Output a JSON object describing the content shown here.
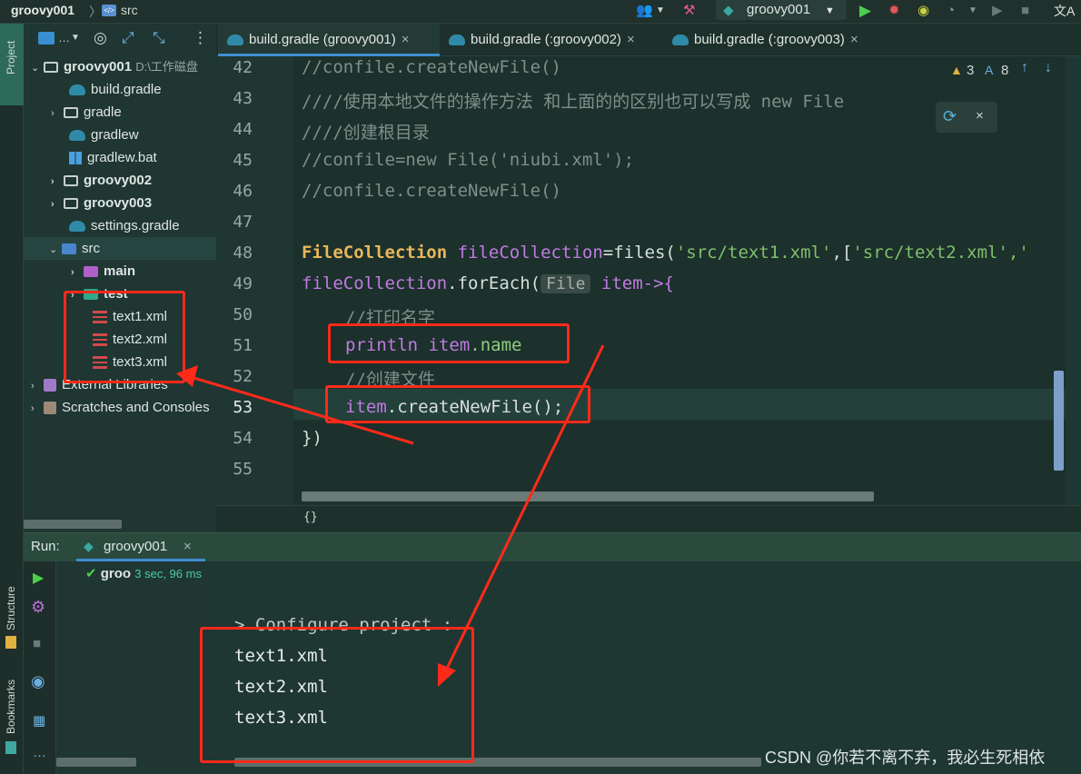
{
  "breadcrumb": {
    "project": "groovy001",
    "separator": "〉",
    "folder": "src"
  },
  "toolbar": {
    "run_config": "groovy001",
    "translate_icon": "文A"
  },
  "left_strip": {
    "project_label": "Project",
    "structure_label": "Structure",
    "bookmarks_label": "Bookmarks"
  },
  "project_tree": {
    "root_name": "groovy001",
    "root_path": "D:\\工作磁盘",
    "items": [
      "build.gradle",
      "gradle",
      "gradlew",
      "gradlew.bat",
      "groovy002",
      "groovy003",
      "settings.gradle",
      "src",
      "main",
      "test",
      "text1.xml",
      "text2.xml",
      "text3.xml",
      "External Libraries",
      "Scratches and Consoles"
    ]
  },
  "tabs": [
    {
      "label": "build.gradle (groovy001)",
      "close": "×"
    },
    {
      "label": "build.gradle (:groovy002)",
      "close": "×"
    },
    {
      "label": "build.gradle (:groovy003)",
      "close": "×"
    }
  ],
  "editor": {
    "line_numbers": [
      "42",
      "43",
      "44",
      "45",
      "46",
      "47",
      "48",
      "49",
      "50",
      "51",
      "52",
      "53",
      "54",
      "55"
    ],
    "warnings": "3",
    "typos": "8",
    "line42": "//confile.createNewFile()",
    "line43": "////使用本地文件的操作方法 和上面的的区别也可以写成 new File",
    "line44": "////创建根目录",
    "line45_a": "//confile=new File('niubi.xml');",
    "line46": "//confile.createNewFile()",
    "line48_kw": "FileCollection",
    "line48_var": "fileCollection",
    "line48_rest": "=files(",
    "line48_s1": "'src/text1.xml'",
    "line48_mid": ",[",
    "line48_s2": "'src/text2.xml'",
    "line48_tail": ",'",
    "line49_var": "fileCollection",
    "line49_rest": ".forEach(",
    "line49_hint": "File",
    "line49_item": "item->{",
    "line50": "//打印名字",
    "line51_fn": "println",
    "line51_item": "item",
    "line51_prop": ".name",
    "line52": "//创建文件",
    "line53_item": "item",
    "line53_rest": ".createNewFile();",
    "line54": "})",
    "braces": "{}"
  },
  "run_panel": {
    "label": "Run:",
    "tab": "groovy001",
    "tab_close": "×",
    "status_name": "groo",
    "status_time": "3 sec, 96 ms",
    "console_lines": [
      "> Configure project :",
      "text1.xml",
      "text2.xml",
      "text3.xml"
    ]
  },
  "watermark": "CSDN @你若不离不弃，我必生死相依",
  "colors": {
    "annotation": "#ff2a1a",
    "accent": "#3f8fd0"
  }
}
